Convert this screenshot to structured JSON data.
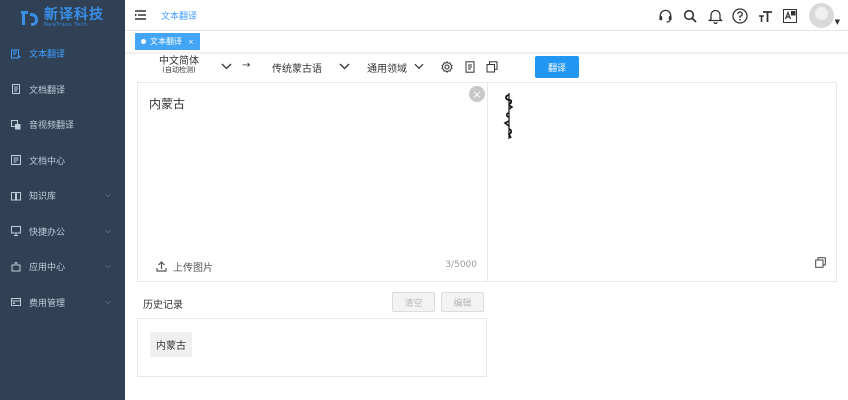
{
  "brand": {
    "name": "新译科技",
    "sub": "NewTrans Tech"
  },
  "sidebar": {
    "items": [
      {
        "label": "文本翻译",
        "icon": "text-translate-icon",
        "active": true,
        "has_arrow": false
      },
      {
        "label": "文档翻译",
        "icon": "document-icon",
        "active": false,
        "has_arrow": false
      },
      {
        "label": "音视频翻译",
        "icon": "media-icon",
        "active": false,
        "has_arrow": false
      },
      {
        "label": "文档中心",
        "icon": "doc-center-icon",
        "active": false,
        "has_arrow": false
      },
      {
        "label": "知识库",
        "icon": "book-icon",
        "active": false,
        "has_arrow": true
      },
      {
        "label": "快捷办公",
        "icon": "monitor-icon",
        "active": false,
        "has_arrow": true
      },
      {
        "label": "应用中心",
        "icon": "puzzle-icon",
        "active": false,
        "has_arrow": true
      },
      {
        "label": "费用管理",
        "icon": "wallet-icon",
        "active": false,
        "has_arrow": true
      }
    ]
  },
  "header": {
    "breadcrumb": "文本翻译"
  },
  "tags": {
    "active": "文本翻译",
    "close": "×"
  },
  "lang": {
    "source": "中文简体",
    "source_sub": "(自动检测)",
    "arrow": "→",
    "target": "传统蒙古语",
    "domain": "通用领域",
    "translate_label": "翻译"
  },
  "editor": {
    "source_text": "内蒙古",
    "upload_label": "上传图片",
    "char_count": "3/5000"
  },
  "history": {
    "title": "历史记录",
    "clear_label": "清空",
    "edit_label": "编辑",
    "items": [
      "内蒙古"
    ]
  },
  "colors": {
    "sidebar": "#304156",
    "accent": "#409eff",
    "button": "#2196f3"
  }
}
